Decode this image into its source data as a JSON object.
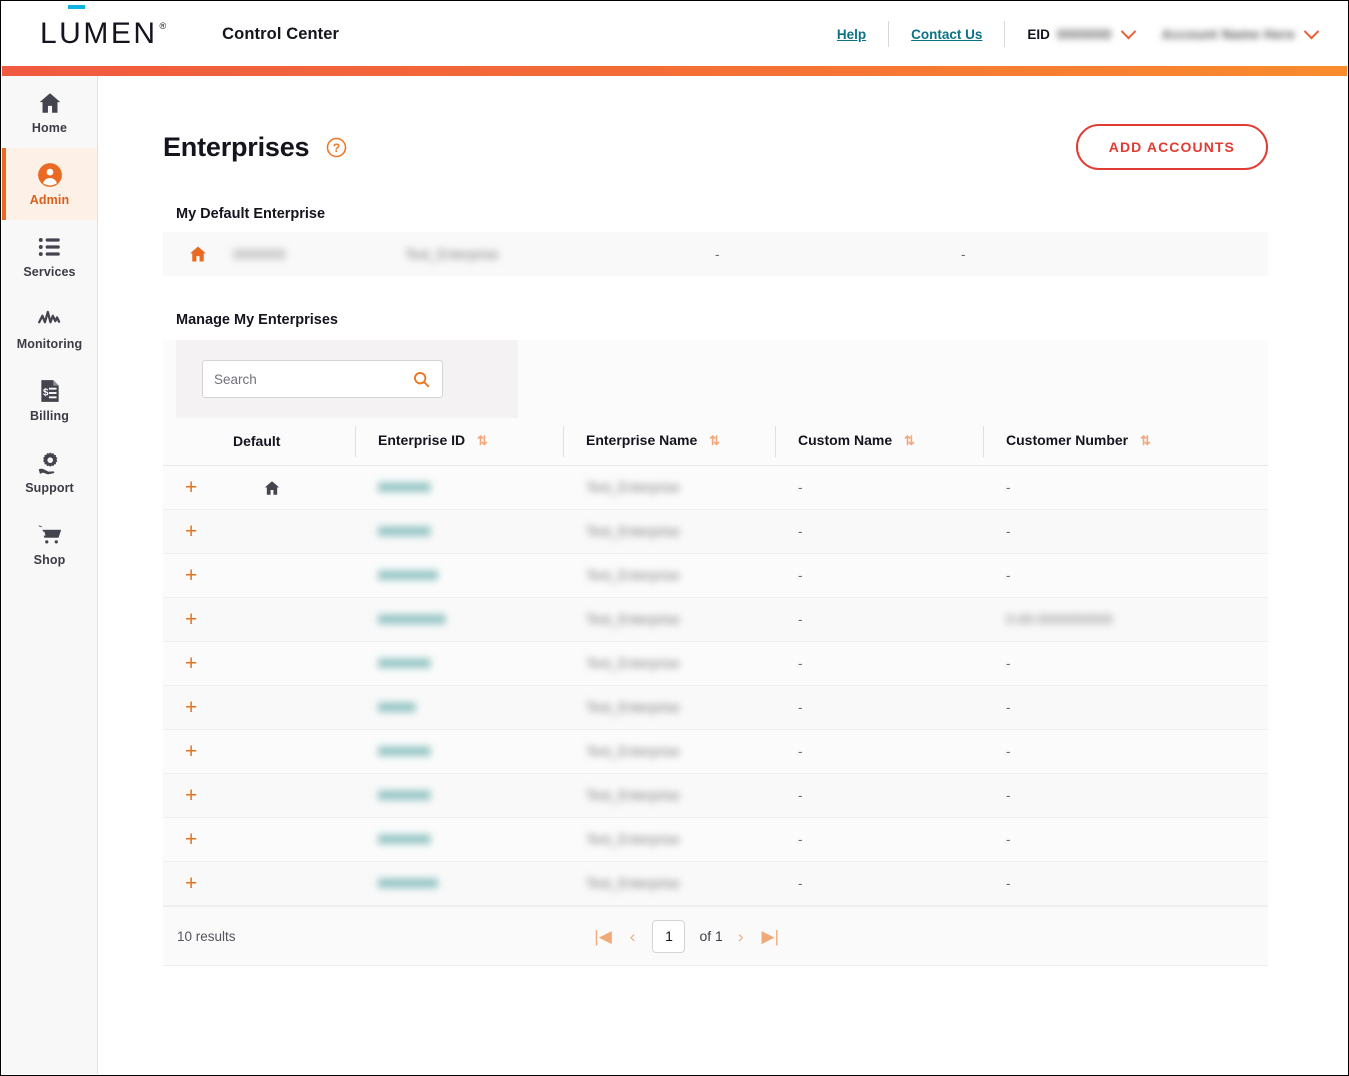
{
  "header": {
    "logo_text": "LUMEN",
    "logo_registered": "®",
    "app_title": "Control Center",
    "help_label": "Help",
    "contact_label": "Contact Us",
    "eid_label": "EID",
    "eid_value": "0000000",
    "account_value": "Account Name Here",
    "accent_start": "#f05a40",
    "accent_end": "#f98b2d"
  },
  "sidebar": {
    "items": [
      {
        "label": "Home",
        "icon": "home-icon",
        "active": false
      },
      {
        "label": "Admin",
        "icon": "user-circle-icon",
        "active": true
      },
      {
        "label": "Services",
        "icon": "list-icon",
        "active": false
      },
      {
        "label": "Monitoring",
        "icon": "activity-icon",
        "active": false
      },
      {
        "label": "Billing",
        "icon": "invoice-icon",
        "active": false
      },
      {
        "label": "Support",
        "icon": "support-gear-hand-icon",
        "active": false
      },
      {
        "label": "Shop",
        "icon": "cart-icon",
        "active": false
      }
    ]
  },
  "main": {
    "page_title": "Enterprises",
    "help_icon": "question-circle-icon",
    "add_accounts_label": "ADD ACCOUNTS",
    "default_section_label": "My Default Enterprise",
    "manage_section_label": "Manage My Enterprises",
    "default_row": {
      "home_icon": "home-icon",
      "enterprise_id": "0000000",
      "enterprise_name": "Test_Enterprise",
      "custom_name": "-",
      "customer_number": "-"
    },
    "search": {
      "placeholder": "Search",
      "value": "",
      "icon": "search-icon"
    },
    "table": {
      "columns": [
        {
          "label": "",
          "sortable": false
        },
        {
          "label": "Default",
          "sortable": false
        },
        {
          "label": "Enterprise ID",
          "sortable": true
        },
        {
          "label": "Enterprise Name",
          "sortable": true
        },
        {
          "label": "Custom Name",
          "sortable": true
        },
        {
          "label": "Customer Number",
          "sortable": true
        }
      ],
      "sort_glyph": "⇅",
      "expand_glyph": "+",
      "rows": [
        {
          "is_default": true,
          "enterprise_id": "0000000",
          "enterprise_name": "Test_Enterprise",
          "custom_name": "-",
          "customer_number": "-"
        },
        {
          "is_default": false,
          "enterprise_id": "0000000",
          "enterprise_name": "Test_Enterprise",
          "custom_name": "-",
          "customer_number": "-"
        },
        {
          "is_default": false,
          "enterprise_id": "00000000",
          "enterprise_name": "Test_Enterprise",
          "custom_name": "-",
          "customer_number": "-"
        },
        {
          "is_default": false,
          "enterprise_id": "000000000",
          "enterprise_name": "Test_Enterprise",
          "custom_name": "-",
          "customer_number": "0-00-0000000000"
        },
        {
          "is_default": false,
          "enterprise_id": "0000000",
          "enterprise_name": "Test_Enterprise",
          "custom_name": "-",
          "customer_number": "-"
        },
        {
          "is_default": false,
          "enterprise_id": "00000",
          "enterprise_name": "Test_Enterprise",
          "custom_name": "-",
          "customer_number": "-"
        },
        {
          "is_default": false,
          "enterprise_id": "0000000",
          "enterprise_name": "Test_Enterprise",
          "custom_name": "-",
          "customer_number": "-"
        },
        {
          "is_default": false,
          "enterprise_id": "0000000",
          "enterprise_name": "Test_Enterprise",
          "custom_name": "-",
          "customer_number": "-"
        },
        {
          "is_default": false,
          "enterprise_id": "0000000",
          "enterprise_name": "Test_Enterprise",
          "custom_name": "-",
          "customer_number": "-"
        },
        {
          "is_default": false,
          "enterprise_id": "00000000",
          "enterprise_name": "Test_Enterprise",
          "custom_name": "-",
          "customer_number": "-"
        }
      ]
    },
    "footer": {
      "results_text": "10 results",
      "first_glyph": "|◀",
      "prev_glyph": "‹",
      "page_value": "1",
      "of_text": "of 1",
      "next_glyph": "›",
      "last_glyph": "▶|"
    }
  }
}
